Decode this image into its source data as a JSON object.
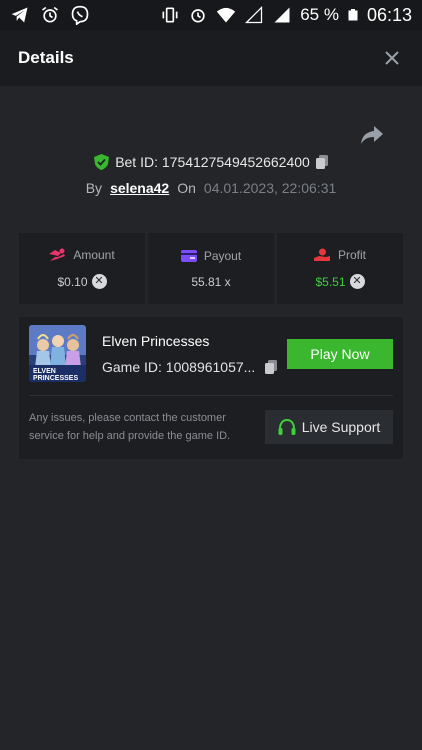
{
  "status_bar": {
    "battery": "65 %",
    "time": "06:13"
  },
  "header": {
    "title": "Details"
  },
  "bet": {
    "bet_id_text": "Bet ID: 1754127549452662400",
    "by_label": "By",
    "user": "selena42",
    "on_label": "On",
    "date": "04.01.2023, 22:06:31"
  },
  "stats": {
    "amount_label": "Amount",
    "amount_value": "$0.10",
    "payout_label": "Payout",
    "payout_value": "55.81 x",
    "profit_label": "Profit",
    "profit_value": "$5.51"
  },
  "game": {
    "name": "Elven Princesses",
    "game_id": "Game ID: 1008961057...",
    "thumb_line1": "ELVEN",
    "thumb_line2": "PRINCESSES",
    "play_label": "Play Now",
    "issue_text": "Any issues, please contact the customer service for help and provide the game ID.",
    "support_label": "Live Support"
  },
  "colors": {
    "accent_green": "#3ab72e",
    "profit_green": "#3fd03a",
    "amount_icon": "#e8336b",
    "payout_icon": "#7c4dff",
    "profit_icon": "#e8363d"
  },
  "icons": [
    "telegram-icon",
    "alarm-icon",
    "viber-icon",
    "vibrate-icon",
    "alarm-icon",
    "wifi-icon",
    "signal-icon",
    "battery-icon",
    "close-icon",
    "share-icon",
    "shield-check-icon",
    "copy-icon",
    "amount-icon",
    "payout-icon",
    "profit-icon",
    "headset-icon"
  ]
}
